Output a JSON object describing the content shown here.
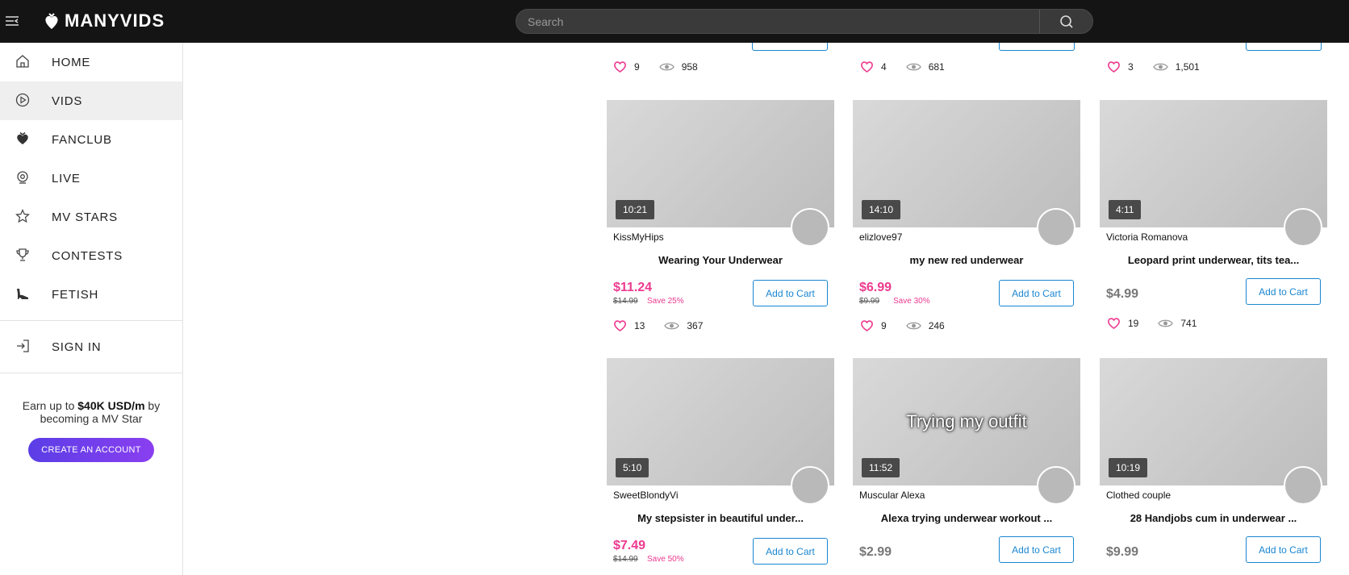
{
  "brand": {
    "name": "MANYVIDS"
  },
  "search": {
    "placeholder": "Search"
  },
  "sidebar": {
    "items": [
      {
        "label": "HOME",
        "icon": "home-icon"
      },
      {
        "label": "VIDS",
        "icon": "play-circle-icon",
        "active": true
      },
      {
        "label": "FANCLUB",
        "icon": "fanclub-heart-icon"
      },
      {
        "label": "LIVE",
        "icon": "webcam-icon"
      },
      {
        "label": "MV STARS",
        "icon": "star-icon"
      },
      {
        "label": "CONTESTS",
        "icon": "trophy-icon"
      },
      {
        "label": "FETISH",
        "icon": "high-heel-icon"
      }
    ],
    "sign_in": "SIGN IN",
    "promo": {
      "prefix": "Earn up to",
      "amount": "$40K USD/m",
      "suffix": "by becoming a MV Star",
      "cta": "CREATE AN ACCOUNT"
    }
  },
  "top_stats": [
    {
      "likes": "9",
      "views": "958"
    },
    {
      "likes": "4",
      "views": "681"
    },
    {
      "likes": "3",
      "views": "1,501"
    }
  ],
  "cards": [
    {
      "duration": "10:21",
      "creator": "KissMyHips",
      "title": "Wearing Your Underwear",
      "price": "$11.24",
      "original_price": "$14.99",
      "save": "Save 25%",
      "cart": "Add to Cart",
      "likes": "13",
      "views": "367"
    },
    {
      "duration": "14:10",
      "creator": "elizlove97",
      "title": "my new red underwear",
      "price": "$6.99",
      "original_price": "$9.99",
      "save": "Save 30%",
      "cart": "Add to Cart",
      "likes": "9",
      "views": "246"
    },
    {
      "duration": "4:11",
      "creator": "Victoria Romanova",
      "title": "Leopard print underwear, tits tea...",
      "price": "$4.99",
      "cart": "Add to Cart",
      "likes": "19",
      "views": "741"
    },
    {
      "duration": "5:10",
      "creator": "SweetBlondyVi",
      "title": "My stepsister in beautiful under...",
      "price": "$7.49",
      "original_price": "$14.99",
      "save": "Save 50%",
      "cart": "Add to Cart"
    },
    {
      "duration": "11:52",
      "creator": "Muscular Alexa",
      "title": "Alexa trying underwear workout ...",
      "thumb_text": "Trying my outfit",
      "price": "$2.99",
      "cart": "Add to Cart"
    },
    {
      "duration": "10:19",
      "creator": "Clothed couple",
      "title": "28 Handjobs cum in underwear ...",
      "price": "$9.99",
      "cart": "Add to Cart"
    }
  ],
  "colors": {
    "accent": "#ec3a8f",
    "link": "#1a86d0",
    "topbar": "#141414"
  }
}
